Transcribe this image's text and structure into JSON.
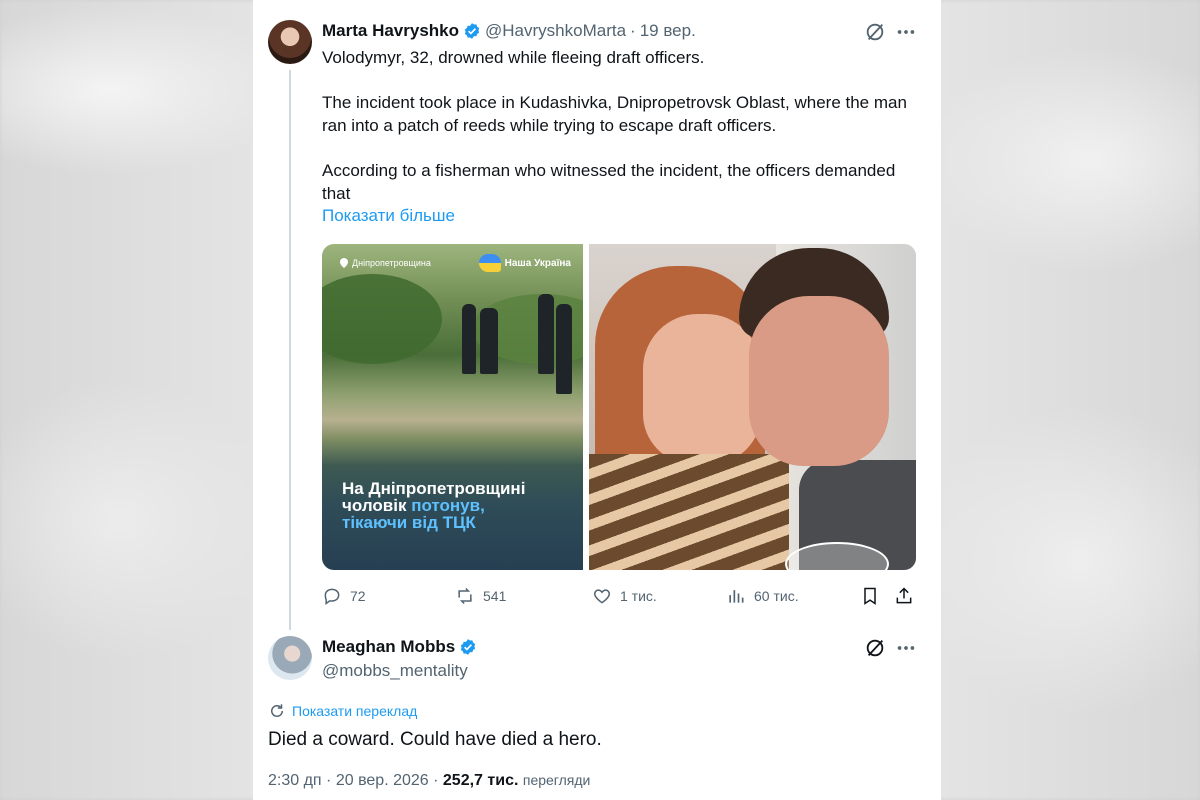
{
  "tweet": {
    "author_name": "Marta Havryshko",
    "handle": "@HavryshkoMarta",
    "separator": "·",
    "date": "19 вер.",
    "paragraphs": [
      "Volodymyr, 32, drowned while fleeing draft officers.",
      "The incident took place in Kudashivka, Dnipropetrovsk Oblast, where the man ran into a patch of reeds while trying to escape draft officers.",
      "According to a fisherman who witnessed the incident, the officers demanded that"
    ],
    "show_more": "Показати більше",
    "media": {
      "image1": {
        "location": "Дніпропетровщина",
        "brand": "Наша Україна",
        "caption_line1": "На Дніпропетровщині",
        "caption_line2a": "чоловік ",
        "caption_line2b": "потонув,",
        "caption_line3": "тікаючи від ТЦК"
      }
    },
    "stats": {
      "replies": "72",
      "retweets": "541",
      "likes": "1 тис.",
      "views": "60 тис."
    }
  },
  "reply": {
    "author_name": "Meaghan Mobbs",
    "handle": "@mobbs_mentality",
    "translate_label": "Показати переклад",
    "text": "Died a coward. Could have died a hero.",
    "time": "2:30 дп",
    "separator": "·",
    "date": "20 вер. 2026",
    "separator2": "·",
    "views_count": "252,7 тис.",
    "views_label": "перегляди"
  },
  "colors": {
    "accent": "#1d9bf0",
    "muted": "#536471",
    "text": "#0f1419"
  },
  "icons": [
    "verified-badge-icon",
    "grok-icon",
    "more-icon",
    "reply-icon",
    "retweet-icon",
    "like-icon",
    "views-icon",
    "bookmark-icon",
    "share-icon",
    "translate-icon",
    "location-pin-icon"
  ]
}
